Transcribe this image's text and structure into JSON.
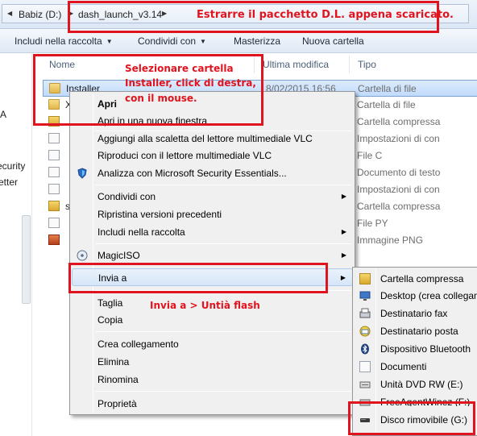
{
  "address_bar": {
    "crumbs": [
      "Babiz (D:)",
      "dash_launch_v3.14"
    ]
  },
  "toolbar": {
    "include": "Includi nella raccolta",
    "share": "Condividi con",
    "burn": "Masterizza",
    "new_folder": "Nuova cartella"
  },
  "nav": {
    "items": [
      "A",
      "ecurity",
      "etter"
    ]
  },
  "columns": {
    "name": "Nome",
    "modified": "Ultima modifica",
    "type": "Tipo"
  },
  "files": [
    {
      "name": "Installer",
      "date": "8/02/2015 16:56",
      "type": "Cartella di file",
      "icon": "folder-icon"
    },
    {
      "name": "X",
      "date": "",
      "type": "Cartella di file",
      "icon": "folder-icon"
    },
    {
      "name": "",
      "date": "",
      "type": "Cartella compressa",
      "icon": "zip-icon"
    },
    {
      "name": "",
      "date": "",
      "type": "Impostazioni di con",
      "icon": "settings-file-icon"
    },
    {
      "name": "",
      "date": "",
      "type": "File C",
      "icon": "document-icon"
    },
    {
      "name": "",
      "date": "",
      "type": "Documento di testo",
      "icon": "document-icon"
    },
    {
      "name": "",
      "date": "",
      "type": "Impostazioni di con",
      "icon": "settings-file-icon"
    },
    {
      "name": "s",
      "date": "",
      "type": "Cartella compressa",
      "icon": "zip-icon"
    },
    {
      "name": "",
      "date": "",
      "type": "File PY",
      "icon": "document-icon"
    },
    {
      "name": "",
      "date": "",
      "type": "Immagine PNG",
      "icon": "image-icon"
    }
  ],
  "context_menu": {
    "open": "Apri",
    "open_new_window": "Apri in una nuova finestra",
    "vlc_add": "Aggiungi alla scaletta del lettore multimediale VLC",
    "vlc_play": "Riproduci con il lettore multimediale VLC",
    "mse_scan": "Analizza con Microsoft Security Essentials...",
    "share_with": "Condividi con",
    "restore": "Ripristina versioni precedenti",
    "include_library": "Includi nella raccolta",
    "magiciso": "MagicISO",
    "send_to": "Invia a",
    "cut": "Taglia",
    "copy": "Copia",
    "create_shortcut": "Crea collegamento",
    "delete": "Elimina",
    "rename": "Rinomina",
    "properties": "Proprietà"
  },
  "submenu": {
    "items": [
      "Cartella compressa",
      "Desktop (crea collegam",
      "Destinatario fax",
      "Destinatario posta",
      "Dispositivo Bluetooth",
      "Documenti",
      "Unità DVD RW (E:)",
      "FreeAgentWinez (F:)",
      "Disco rimovibile (G:)"
    ]
  },
  "annotations": {
    "extract_note": "Estrarre il pacchetto D.L. appena scaricato.",
    "select_note": [
      "Selezionare cartella",
      "Installer, click di destra,",
      "con il mouse."
    ],
    "sendto_note": "Invia a > Untià flash"
  },
  "colors": {
    "annotation_red": "#e0141f",
    "selection_blue": "#c1dbfc"
  }
}
